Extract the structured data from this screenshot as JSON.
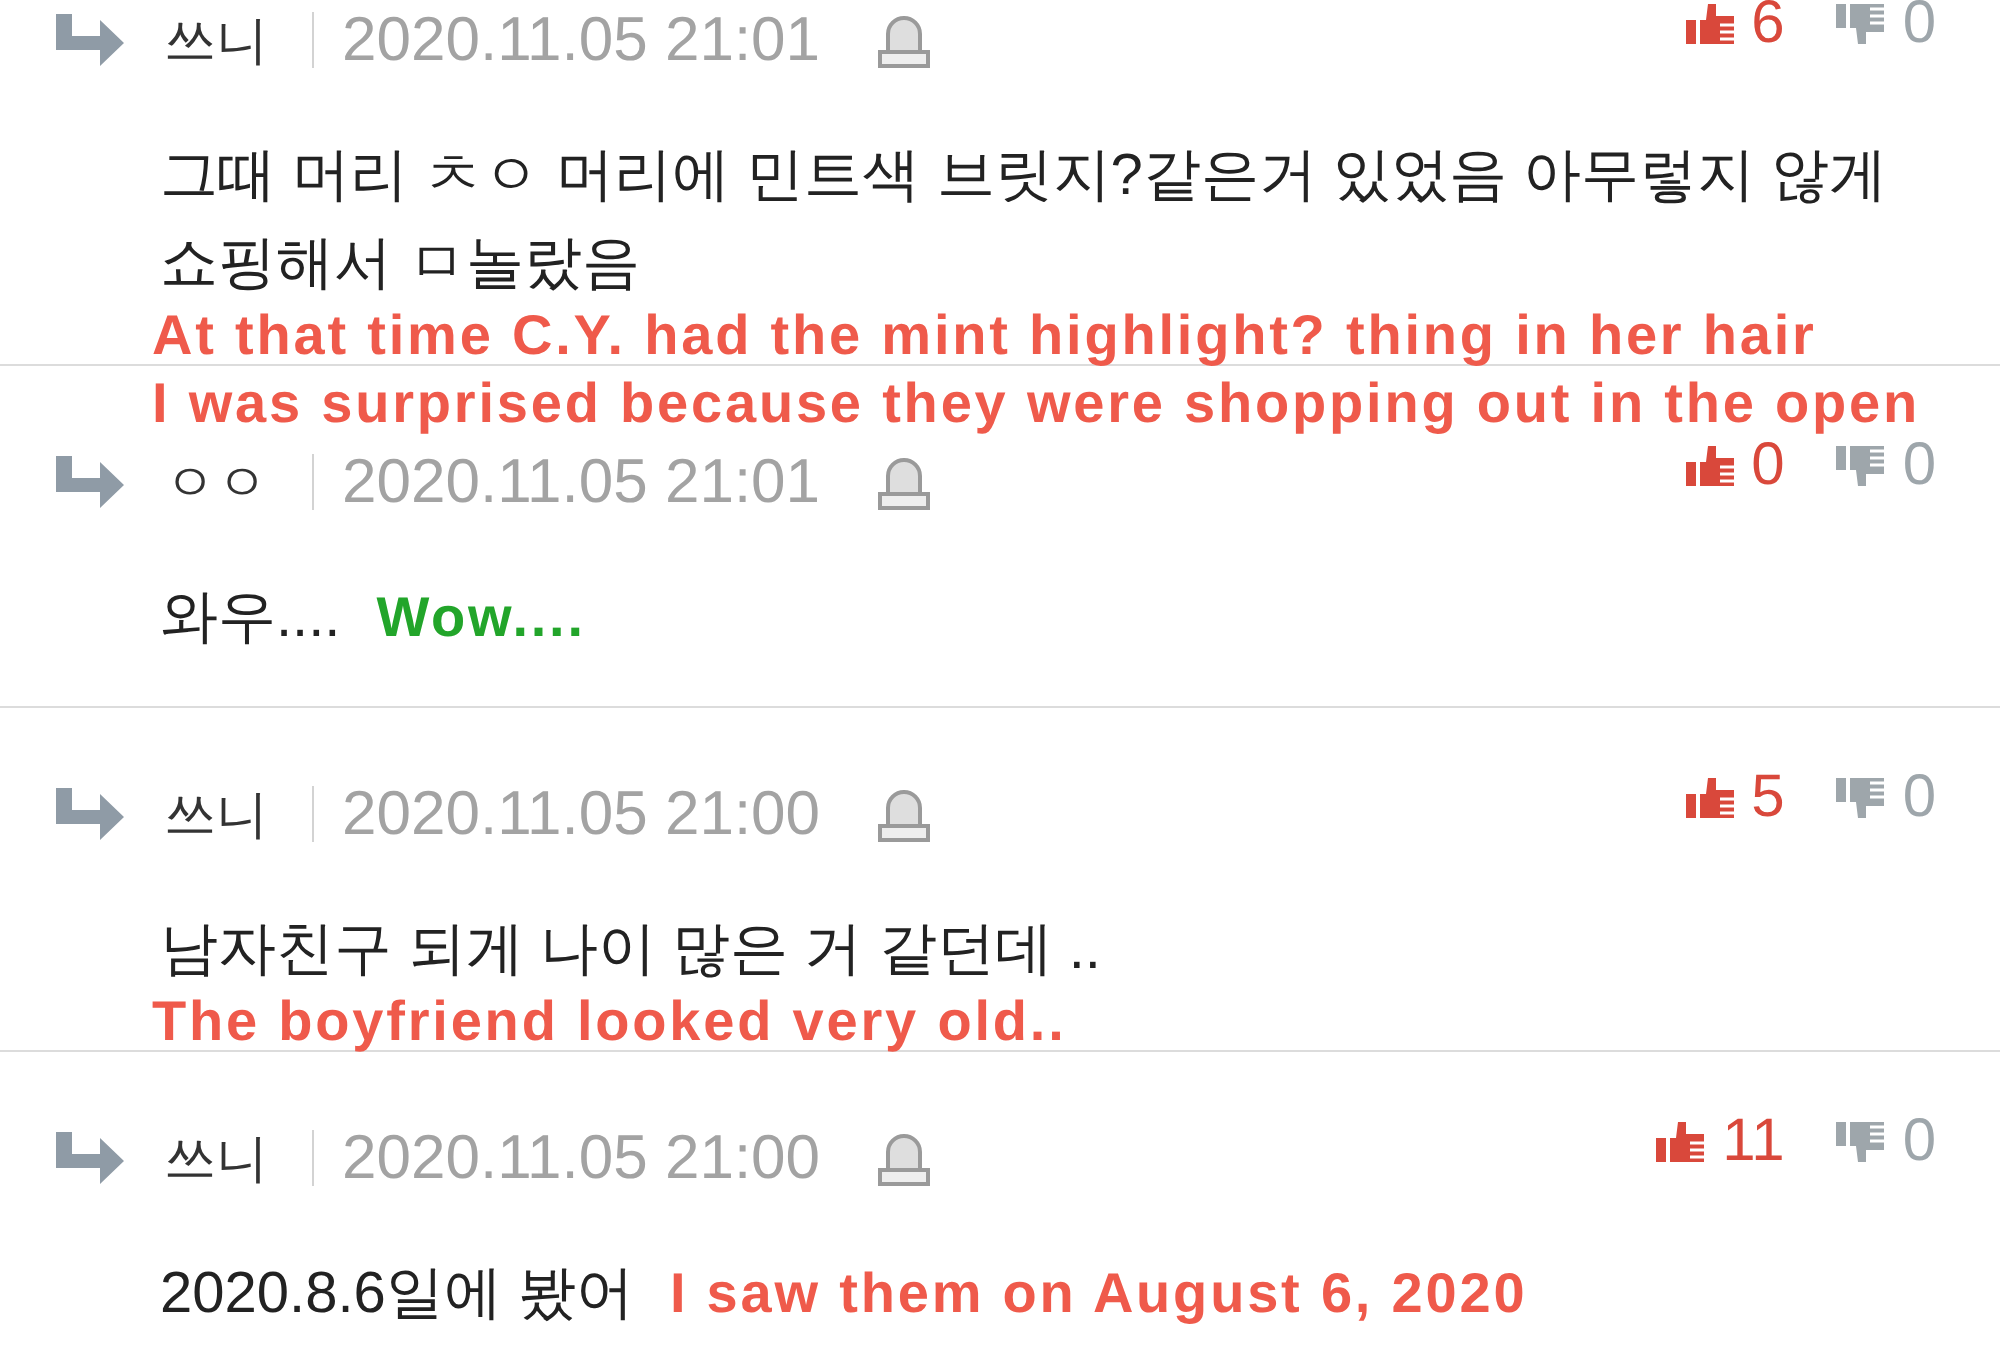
{
  "comments": [
    {
      "author": "쓰니",
      "date": "2020.11.05 21:01",
      "likes": "6",
      "dislikes": "0",
      "body": "그때 머리 ㅊㅇ 머리에 민트색 브릿지?같은거 있었음 아무렇지 않게 쇼핑해서 ㅁ놀랐음",
      "translation": {
        "kind": "below",
        "color": "#ef5a4b",
        "lines": [
          "At that time C.Y. had the mint highlight? thing in her hair",
          "I was surprised because they were shopping out in the open"
        ]
      }
    },
    {
      "author": "ㅇㅇ",
      "date": "2020.11.05 21:01",
      "likes": "0",
      "dislikes": "0",
      "body": "와우....",
      "translation": {
        "kind": "inline",
        "color": "#22a52a",
        "lines": [
          "Wow...."
        ]
      }
    },
    {
      "author": "쓰니",
      "date": "2020.11.05 21:00",
      "likes": "5",
      "dislikes": "0",
      "body": "남자친구 되게 나이 많은 거 같던데 ..",
      "translation": {
        "kind": "below",
        "color": "#ef5a4b",
        "lines": [
          "The boyfriend looked very old.."
        ]
      }
    },
    {
      "author": "쓰니",
      "date": "2020.11.05 21:00",
      "likes": "11",
      "dislikes": "0",
      "body": "2020.8.6일에 봤어",
      "translation": {
        "kind": "inline",
        "color": "#ef5a4b",
        "lines": [
          "I saw them on August 6, 2020"
        ]
      }
    }
  ]
}
